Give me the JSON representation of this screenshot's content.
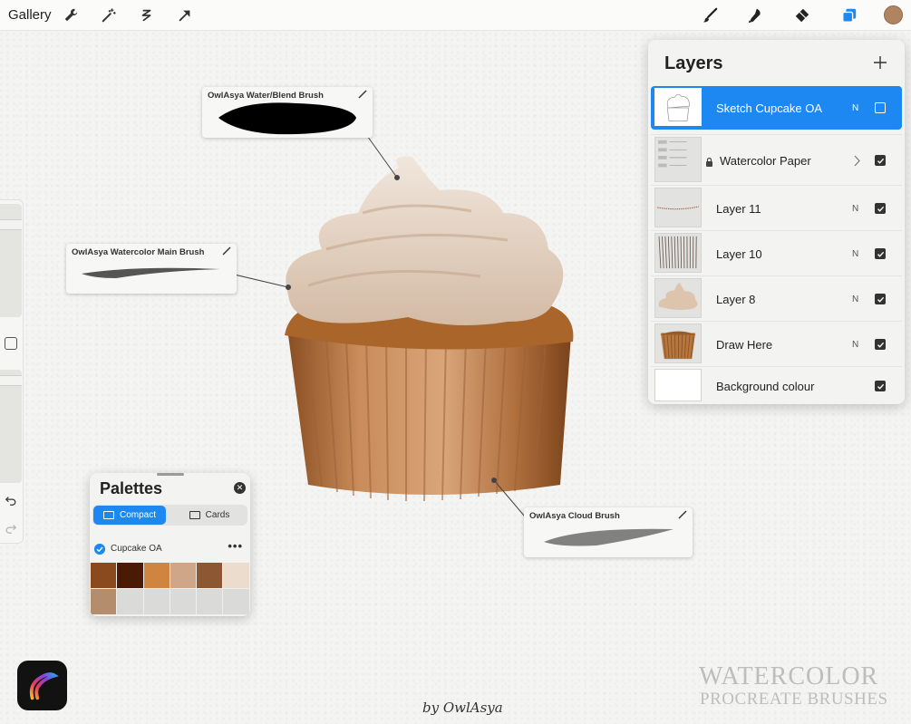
{
  "toolbar": {
    "gallery_label": "Gallery",
    "left_tools": [
      "wrench-icon",
      "magic-wand-icon",
      "selection-icon",
      "transform-arrow-icon"
    ],
    "right_tools": [
      "brush-icon",
      "smudge-icon",
      "eraser-icon",
      "layers-icon"
    ],
    "active_tool": "layers-icon",
    "current_color": "#b08460",
    "accent_color": "#1e88f2"
  },
  "sidebar": {
    "brush_size_level": 0.85,
    "opacity_level": 0.95
  },
  "brush_labels": [
    {
      "name": "OwlAsya Water/Blend Brush"
    },
    {
      "name": "OwlAsya Watercolor Main Brush"
    },
    {
      "name": "OwlAsya Cloud Brush"
    }
  ],
  "layers": {
    "title": "Layers",
    "rows": [
      {
        "name": "Sketch Cupcake OA",
        "blend": "N",
        "visible": false,
        "active": true,
        "locked": false,
        "group": false,
        "thumb": "sketch"
      },
      {
        "name": "Watercolor Paper",
        "blend": "",
        "visible": true,
        "active": false,
        "locked": true,
        "group": true,
        "thumb": "group"
      },
      {
        "name": "Layer 11",
        "blend": "N",
        "visible": true,
        "active": false,
        "locked": false,
        "group": false,
        "thumb": "line"
      },
      {
        "name": "Layer 10",
        "blend": "N",
        "visible": true,
        "active": false,
        "locked": false,
        "group": false,
        "thumb": "stripes"
      },
      {
        "name": "Layer 8",
        "blend": "N",
        "visible": true,
        "active": false,
        "locked": false,
        "group": false,
        "thumb": "frosting"
      },
      {
        "name": "Draw Here",
        "blend": "N",
        "visible": true,
        "active": false,
        "locked": false,
        "group": false,
        "thumb": "cup"
      },
      {
        "name": "Background colour",
        "blend": "",
        "visible": true,
        "active": false,
        "locked": false,
        "group": false,
        "thumb": "white"
      }
    ]
  },
  "palettes": {
    "title": "Palettes",
    "tabs": {
      "compact": "Compact",
      "cards": "Cards"
    },
    "active_tab": "compact",
    "palette_name": "Cupcake OA",
    "swatches": [
      "#8a4a1e",
      "#4a1a05",
      "#cf853f",
      "#cfa688",
      "#8d5734",
      "#ecdccd",
      "#b48d6c",
      "#dadad8",
      "#dadad8",
      "#dadad8",
      "#dadad8",
      "#dadad8"
    ]
  },
  "signature": "by OwlAsya",
  "watermark": {
    "line1": "WATERCOLOR",
    "line2": "PROCREATE BRUSHES"
  }
}
